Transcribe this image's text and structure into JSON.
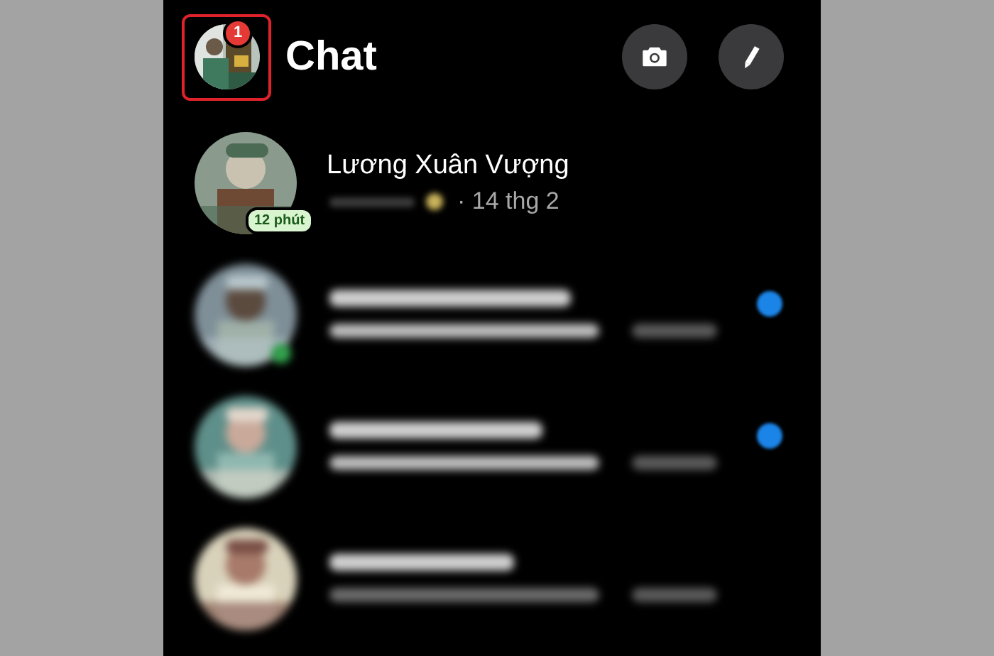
{
  "header": {
    "title": "Chat",
    "notification_count": "1",
    "highlighted": true
  },
  "actions": [
    {
      "kind": "camera"
    },
    {
      "kind": "compose"
    }
  ],
  "chats": [
    {
      "kind": "visible",
      "name": "Lương Xuân Vượng",
      "time": "· 14 thg 2",
      "active_ago": "12 phút",
      "unread": false,
      "online": false
    },
    {
      "kind": "blurred",
      "unread": true,
      "online": true
    },
    {
      "kind": "blurred",
      "unread": true,
      "online": false
    },
    {
      "kind": "blurred",
      "unread": false,
      "online": false
    }
  ]
}
